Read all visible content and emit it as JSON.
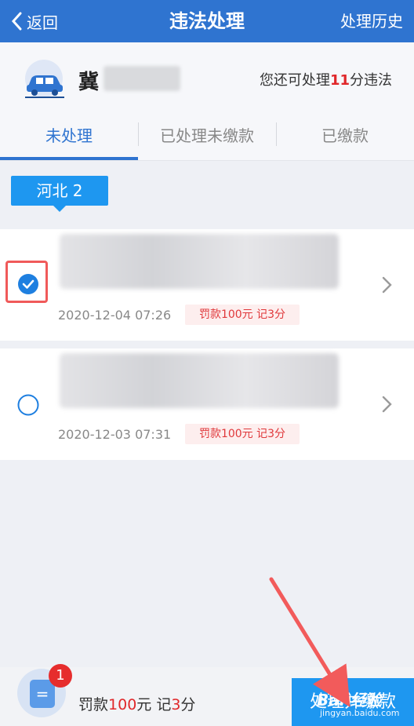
{
  "topbar": {
    "back_label": "返回",
    "title": "违法处理",
    "history_label": "处理历史",
    "color": "#2f74d0"
  },
  "vehicle": {
    "plate_prefix": "冀",
    "remaining_prefix": "您还可处理",
    "remaining_points": "11",
    "remaining_suffix": "分违法",
    "icon": "car-icon"
  },
  "tabs": [
    {
      "label": "未处理",
      "active": true
    },
    {
      "label": "已处理未缴款",
      "active": false
    },
    {
      "label": "已缴款",
      "active": false
    }
  ],
  "region_tag": "河北 2",
  "violations": [
    {
      "date": "2020-12-04 07:26",
      "fine_label": "罚款100元 记3分",
      "checked": true
    },
    {
      "date": "2020-12-03 07:31",
      "fine_label": "罚款100元 记3分",
      "checked": false
    }
  ],
  "footer": {
    "badge_count": "1",
    "doc_icon_glyph": "=",
    "sum_prefix": "罚款",
    "sum_amount": "100",
    "sum_mid": "元 记",
    "sum_points": "3",
    "sum_suffix": "分",
    "pay_label": "处理并缴款"
  },
  "watermark": {
    "brand": "Bai 经验",
    "url": "jingyan.baidu.com"
  },
  "colors": {
    "accent": "#1e97f0",
    "danger": "#e0272a"
  }
}
